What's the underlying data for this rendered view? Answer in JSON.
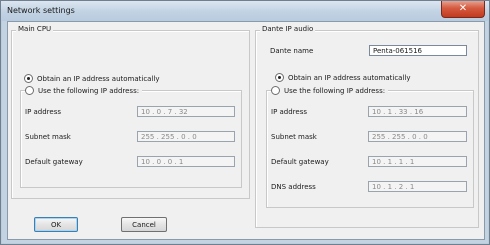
{
  "window": {
    "title": "Network settings",
    "close_icon": "✕"
  },
  "main_cpu": {
    "title": "Main CPU",
    "obtain_auto_label": "Obtain an IP address automatically",
    "use_following_label": "Use the following IP address:",
    "ip_label": "IP address",
    "ip_value": "10  .  0  .  7  .  32",
    "subnet_label": "Subnet mask",
    "subnet_value": "255 . 255 .  0  .  0",
    "gateway_label": "Default gateway",
    "gateway_value": "10  .  0  .  0  .  1"
  },
  "dante": {
    "title": "Dante IP audio",
    "name_label": "Dante name",
    "name_value": "Penta-061516",
    "obtain_auto_label": "Obtain an IP address automatically",
    "use_following_label": "Use the following IP address:",
    "ip_label": "IP address",
    "ip_value": "10  .  1  .  33  .  16",
    "subnet_label": "Subnet mask",
    "subnet_value": "255 . 255 .  0  .  0",
    "gateway_label": "Default gateway",
    "gateway_value": "10  .  1  .  1  .  1",
    "dns_label": "DNS address",
    "dns_value": "10  .  1  .  2  .  1"
  },
  "buttons": {
    "ok": "OK",
    "cancel": "Cancel"
  }
}
